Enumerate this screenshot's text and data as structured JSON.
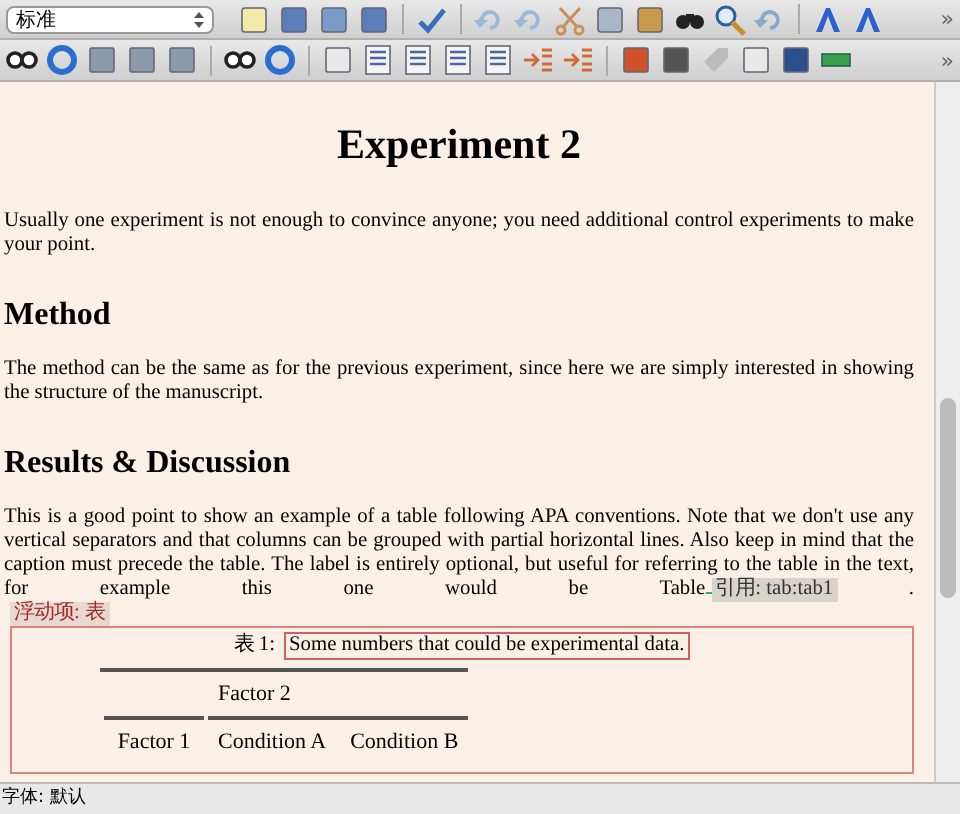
{
  "toolbar": {
    "style_dropdown": "标准",
    "overflow_button": "»"
  },
  "toolbar_2": {
    "overflow_button": "»"
  },
  "document": {
    "title": "Experiment 2",
    "intro": "Usually one experiment is not enough to convince anyone; you need additional control experiments to make your point.",
    "sections": [
      {
        "heading": "Method",
        "text": "The method can be the same as for the previous experiment, since here we are simply interested in showing the structure of the manuscript."
      },
      {
        "heading": "Results & Discussion",
        "text": "This is a good point to show an example of a table following APA conventions. Note that we don't use any vertical separators and that columns can be grouped with partial horizontal lines. Also keep in mind that the caption must precede the table. The label is entirely optional, but useful for referring to the table in the text, for example this one would be Table",
        "reference": "引用: tab:tab1",
        "after_reference": "."
      }
    ],
    "float": {
      "label": "浮动项: 表",
      "caption_number": "表 1:",
      "caption": "Some numbers that could be experimental data.",
      "table": {
        "group_header": "Factor 2",
        "columns": [
          "Factor 1",
          "Condition A",
          "Condition B"
        ]
      }
    }
  },
  "status_bar": "字体: 默认"
}
